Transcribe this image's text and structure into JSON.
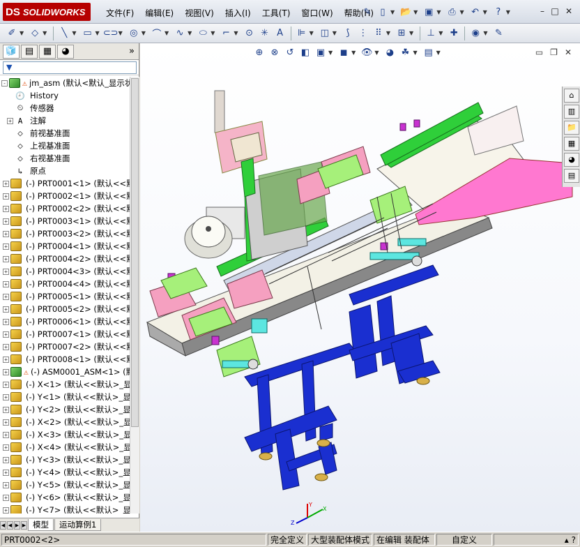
{
  "app": {
    "logo_prefix": "DS",
    "logo": "SOLIDWORKS"
  },
  "menu": [
    "文件(F)",
    "编辑(E)",
    "视图(V)",
    "插入(I)",
    "工具(T)",
    "窗口(W)",
    "帮助(H)"
  ],
  "window_controls": [
    "–",
    "□",
    "✕"
  ],
  "feature_tree": {
    "filter_icon": "▼",
    "rows": [
      {
        "pm": "-",
        "icon": "asm",
        "warn": "⚠",
        "text": "jm_asm  (默认<默认_显示状"
      },
      {
        "pm": "",
        "icon": "history",
        "text": "History"
      },
      {
        "pm": "",
        "icon": "sensor",
        "text": "传感器"
      },
      {
        "pm": "+",
        "icon": "annot",
        "text": "注解"
      },
      {
        "pm": "",
        "icon": "plane",
        "text": "前视基准面"
      },
      {
        "pm": "",
        "icon": "plane",
        "text": "上视基准面"
      },
      {
        "pm": "",
        "icon": "plane",
        "text": "右视基准面"
      },
      {
        "pm": "",
        "icon": "origin",
        "text": "原点"
      },
      {
        "pm": "+",
        "icon": "part",
        "text": "(-) PRT0001<1> (默认<<默"
      },
      {
        "pm": "+",
        "icon": "part",
        "text": "(-) PRT0002<1> (默认<<默"
      },
      {
        "pm": "+",
        "icon": "part",
        "text": "(-) PRT0002<2> (默认<<默"
      },
      {
        "pm": "+",
        "icon": "part",
        "text": "(-) PRT0003<1> (默认<<默"
      },
      {
        "pm": "+",
        "icon": "part",
        "text": "(-) PRT0003<2> (默认<<默"
      },
      {
        "pm": "+",
        "icon": "part",
        "text": "(-) PRT0004<1> (默认<<默"
      },
      {
        "pm": "+",
        "icon": "part",
        "text": "(-) PRT0004<2> (默认<<默"
      },
      {
        "pm": "+",
        "icon": "part",
        "text": "(-) PRT0004<3> (默认<<默"
      },
      {
        "pm": "+",
        "icon": "part",
        "text": "(-) PRT0004<4> (默认<<默"
      },
      {
        "pm": "+",
        "icon": "part",
        "text": "(-) PRT0005<1> (默认<<默"
      },
      {
        "pm": "+",
        "icon": "part",
        "text": "(-) PRT0005<2> (默认<<默"
      },
      {
        "pm": "+",
        "icon": "part",
        "text": "(-) PRT0006<1> (默认<<默"
      },
      {
        "pm": "+",
        "icon": "part",
        "text": "(-) PRT0007<1> (默认<<默"
      },
      {
        "pm": "+",
        "icon": "part",
        "text": "(-) PRT0007<2> (默认<<默"
      },
      {
        "pm": "+",
        "icon": "part",
        "text": "(-) PRT0008<1> (默认<<默"
      },
      {
        "pm": "+",
        "icon": "asm",
        "warn": "⚠",
        "text": "(-) ASM0001_ASM<1> (默"
      },
      {
        "pm": "+",
        "icon": "part",
        "text": "(-) X<1> (默认<<默认>_显"
      },
      {
        "pm": "+",
        "icon": "part",
        "text": "(-) Y<1> (默认<<默认>_显"
      },
      {
        "pm": "+",
        "icon": "part",
        "text": "(-) Y<2> (默认<<默认>_显"
      },
      {
        "pm": "+",
        "icon": "part",
        "text": "(-) X<2> (默认<<默认>_显"
      },
      {
        "pm": "+",
        "icon": "part",
        "text": "(-) X<3> (默认<<默认>_显"
      },
      {
        "pm": "+",
        "icon": "part",
        "text": "(-) X<4> (默认<<默认>_显"
      },
      {
        "pm": "+",
        "icon": "part",
        "text": "(-) Y<3> (默认<<默认>_显"
      },
      {
        "pm": "+",
        "icon": "part",
        "text": "(-) Y<4> (默认<<默认>_显"
      },
      {
        "pm": "+",
        "icon": "part",
        "text": "(-) Y<5> (默认<<默认>_显"
      },
      {
        "pm": "+",
        "icon": "part",
        "text": "(-) Y<6> (默认<<默认>_显"
      },
      {
        "pm": "+",
        "icon": "part",
        "text": "(-) Y<7> (默认<<默认>_显"
      }
    ]
  },
  "bottom_tabs": [
    "模型",
    "运动算例1"
  ],
  "status": {
    "selection": "PRT0002<2>",
    "defined": "完全定义",
    "mode": "大型装配体模式",
    "editing": "在编辑 装配体",
    "custom": "自定义"
  },
  "colors": {
    "frame_blue": "#1a2fd0",
    "belt_green": "#2fcf3a",
    "pink": "#ff78d0",
    "accent_red": "#b60000"
  }
}
